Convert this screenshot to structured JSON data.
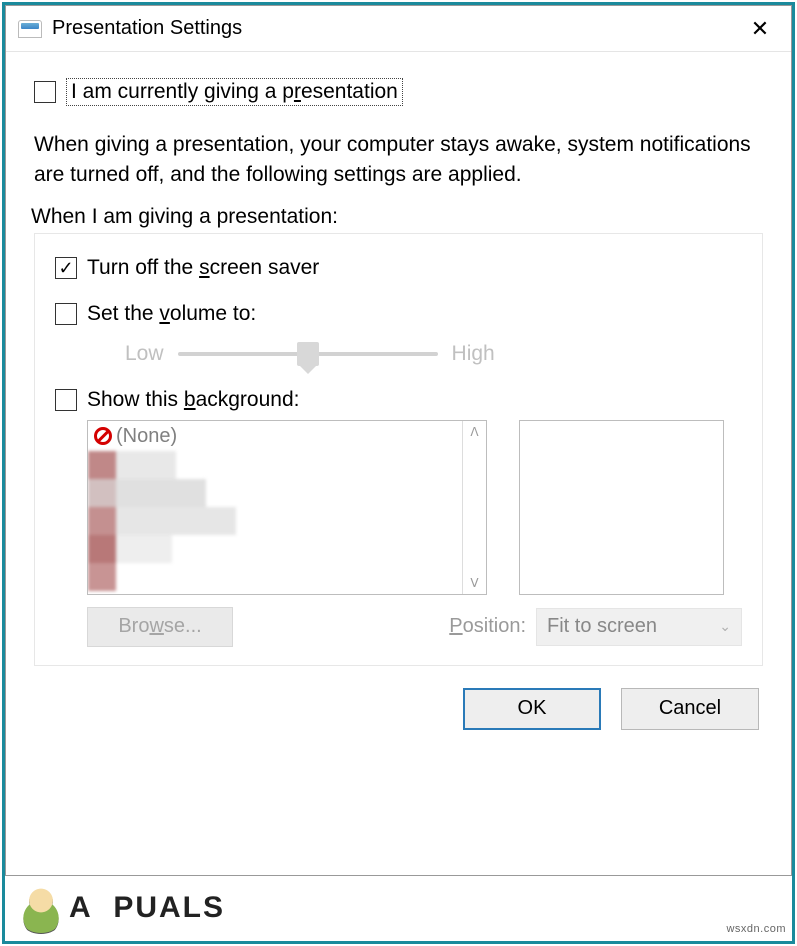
{
  "window": {
    "title": "Presentation Settings",
    "close_glyph": "✕"
  },
  "main": {
    "presenting_checkbox": {
      "checked": false,
      "label_pre": "I am currently giving a p",
      "label_key": "r",
      "label_post": "esentation"
    },
    "description": "When giving a presentation, your computer stays awake, system notifications are turned off, and the following settings are applied.",
    "section_label": "When I am giving a presentation:"
  },
  "group": {
    "screensaver": {
      "checked": true,
      "label_pre": "Turn off the ",
      "label_key": "s",
      "label_post": "creen saver"
    },
    "volume": {
      "checked": false,
      "label_pre": "Set the ",
      "label_key": "v",
      "label_post": "olume to:",
      "low": "Low",
      "high": "High"
    },
    "background": {
      "checked": false,
      "label_pre": "Show this ",
      "label_key": "b",
      "label_post": "ackground:",
      "none_item": "(None)",
      "browse_pre": "Bro",
      "browse_key": "w",
      "browse_post": "se...",
      "position_pre": "P",
      "position_key": "o",
      "position_post": "sition:",
      "position_value": "Fit to screen"
    }
  },
  "buttons": {
    "ok": "OK",
    "cancel": "Cancel"
  },
  "watermark": {
    "brand_pre": "A",
    "brand_post": "PUALS",
    "source": "wsxdn.com"
  }
}
